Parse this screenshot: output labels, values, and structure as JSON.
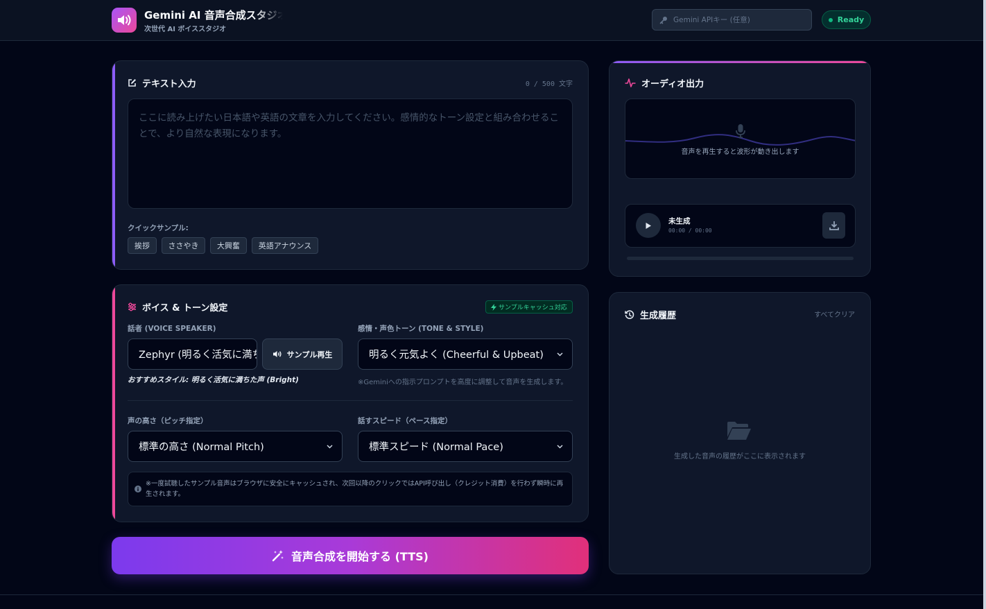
{
  "header": {
    "title": "Gemini AI 音声合成スタジオ",
    "subtitle": "次世代 AI ボイススタジオ",
    "api_key_placeholder": "Gemini APIキー (任意)",
    "status": "Ready"
  },
  "text_input": {
    "title": "テキスト入力",
    "char_count": "0 / 500 文字",
    "placeholder": "ここに読み上げたい日本語や英語の文章を入力してください。感情的なトーン設定と組み合わせることで、より自然な表現になります。",
    "quick_label": "クイックサンプル:",
    "quick_samples": [
      "挨拶",
      "ささやき",
      "大興奮",
      "英語アナウンス"
    ]
  },
  "voice_settings": {
    "title": "ボイス & トーン設定",
    "cache_badge": "サンプルキャッシュ対応",
    "speaker_label": "話者 (VOICE SPEAKER)",
    "speaker_value": "Zephyr (明るく活気に満ちた声)",
    "sample_button": "サンプル再生",
    "recommend": "おすすめスタイル: 明るく活気に満ちた声 (Bright)",
    "tone_label": "感情・声色トーン (TONE & STYLE)",
    "tone_value": "明るく元気よく (Cheerful & Upbeat)",
    "tone_hint": "※Geminiへの指示プロンプトを高度に調整して音声を生成します。",
    "pitch_label": "声の高さ（ピッチ指定）",
    "pitch_value": "標準の高さ (Normal Pitch)",
    "pace_label": "話すスピード（ペース指定）",
    "pace_value": "標準スピード (Normal Pace)",
    "info": "※一度試聴したサンプル音声はブラウザに安全にキャッシュされ、次回以降のクリックではAPI呼び出し（クレジット消費）を行わず瞬時に再生されます。"
  },
  "generate_button": "音声合成を開始する (TTS)",
  "audio_output": {
    "title": "オーディオ出力",
    "wave_hint": "音声を再生すると波形が動き出します",
    "track_title": "未生成",
    "track_time": "00:00 / 00:00",
    "progress": 0
  },
  "history": {
    "title": "生成履歴",
    "clear_all": "すべてクリア",
    "empty_text": "生成した音声の履歴がここに表示されます"
  },
  "colors": {
    "accent_purple": "#8b5cf6",
    "accent_pink": "#ec4899",
    "status_green": "#10b981"
  },
  "icons": [
    "speaker-icon",
    "key-icon",
    "edit-icon",
    "sliders-icon",
    "bolt-icon",
    "volume-icon",
    "chevron-down-icon",
    "info-icon",
    "magic-wand-icon",
    "waveform-icon",
    "microphone-icon",
    "play-icon",
    "download-icon",
    "history-icon",
    "folder-open-icon"
  ]
}
